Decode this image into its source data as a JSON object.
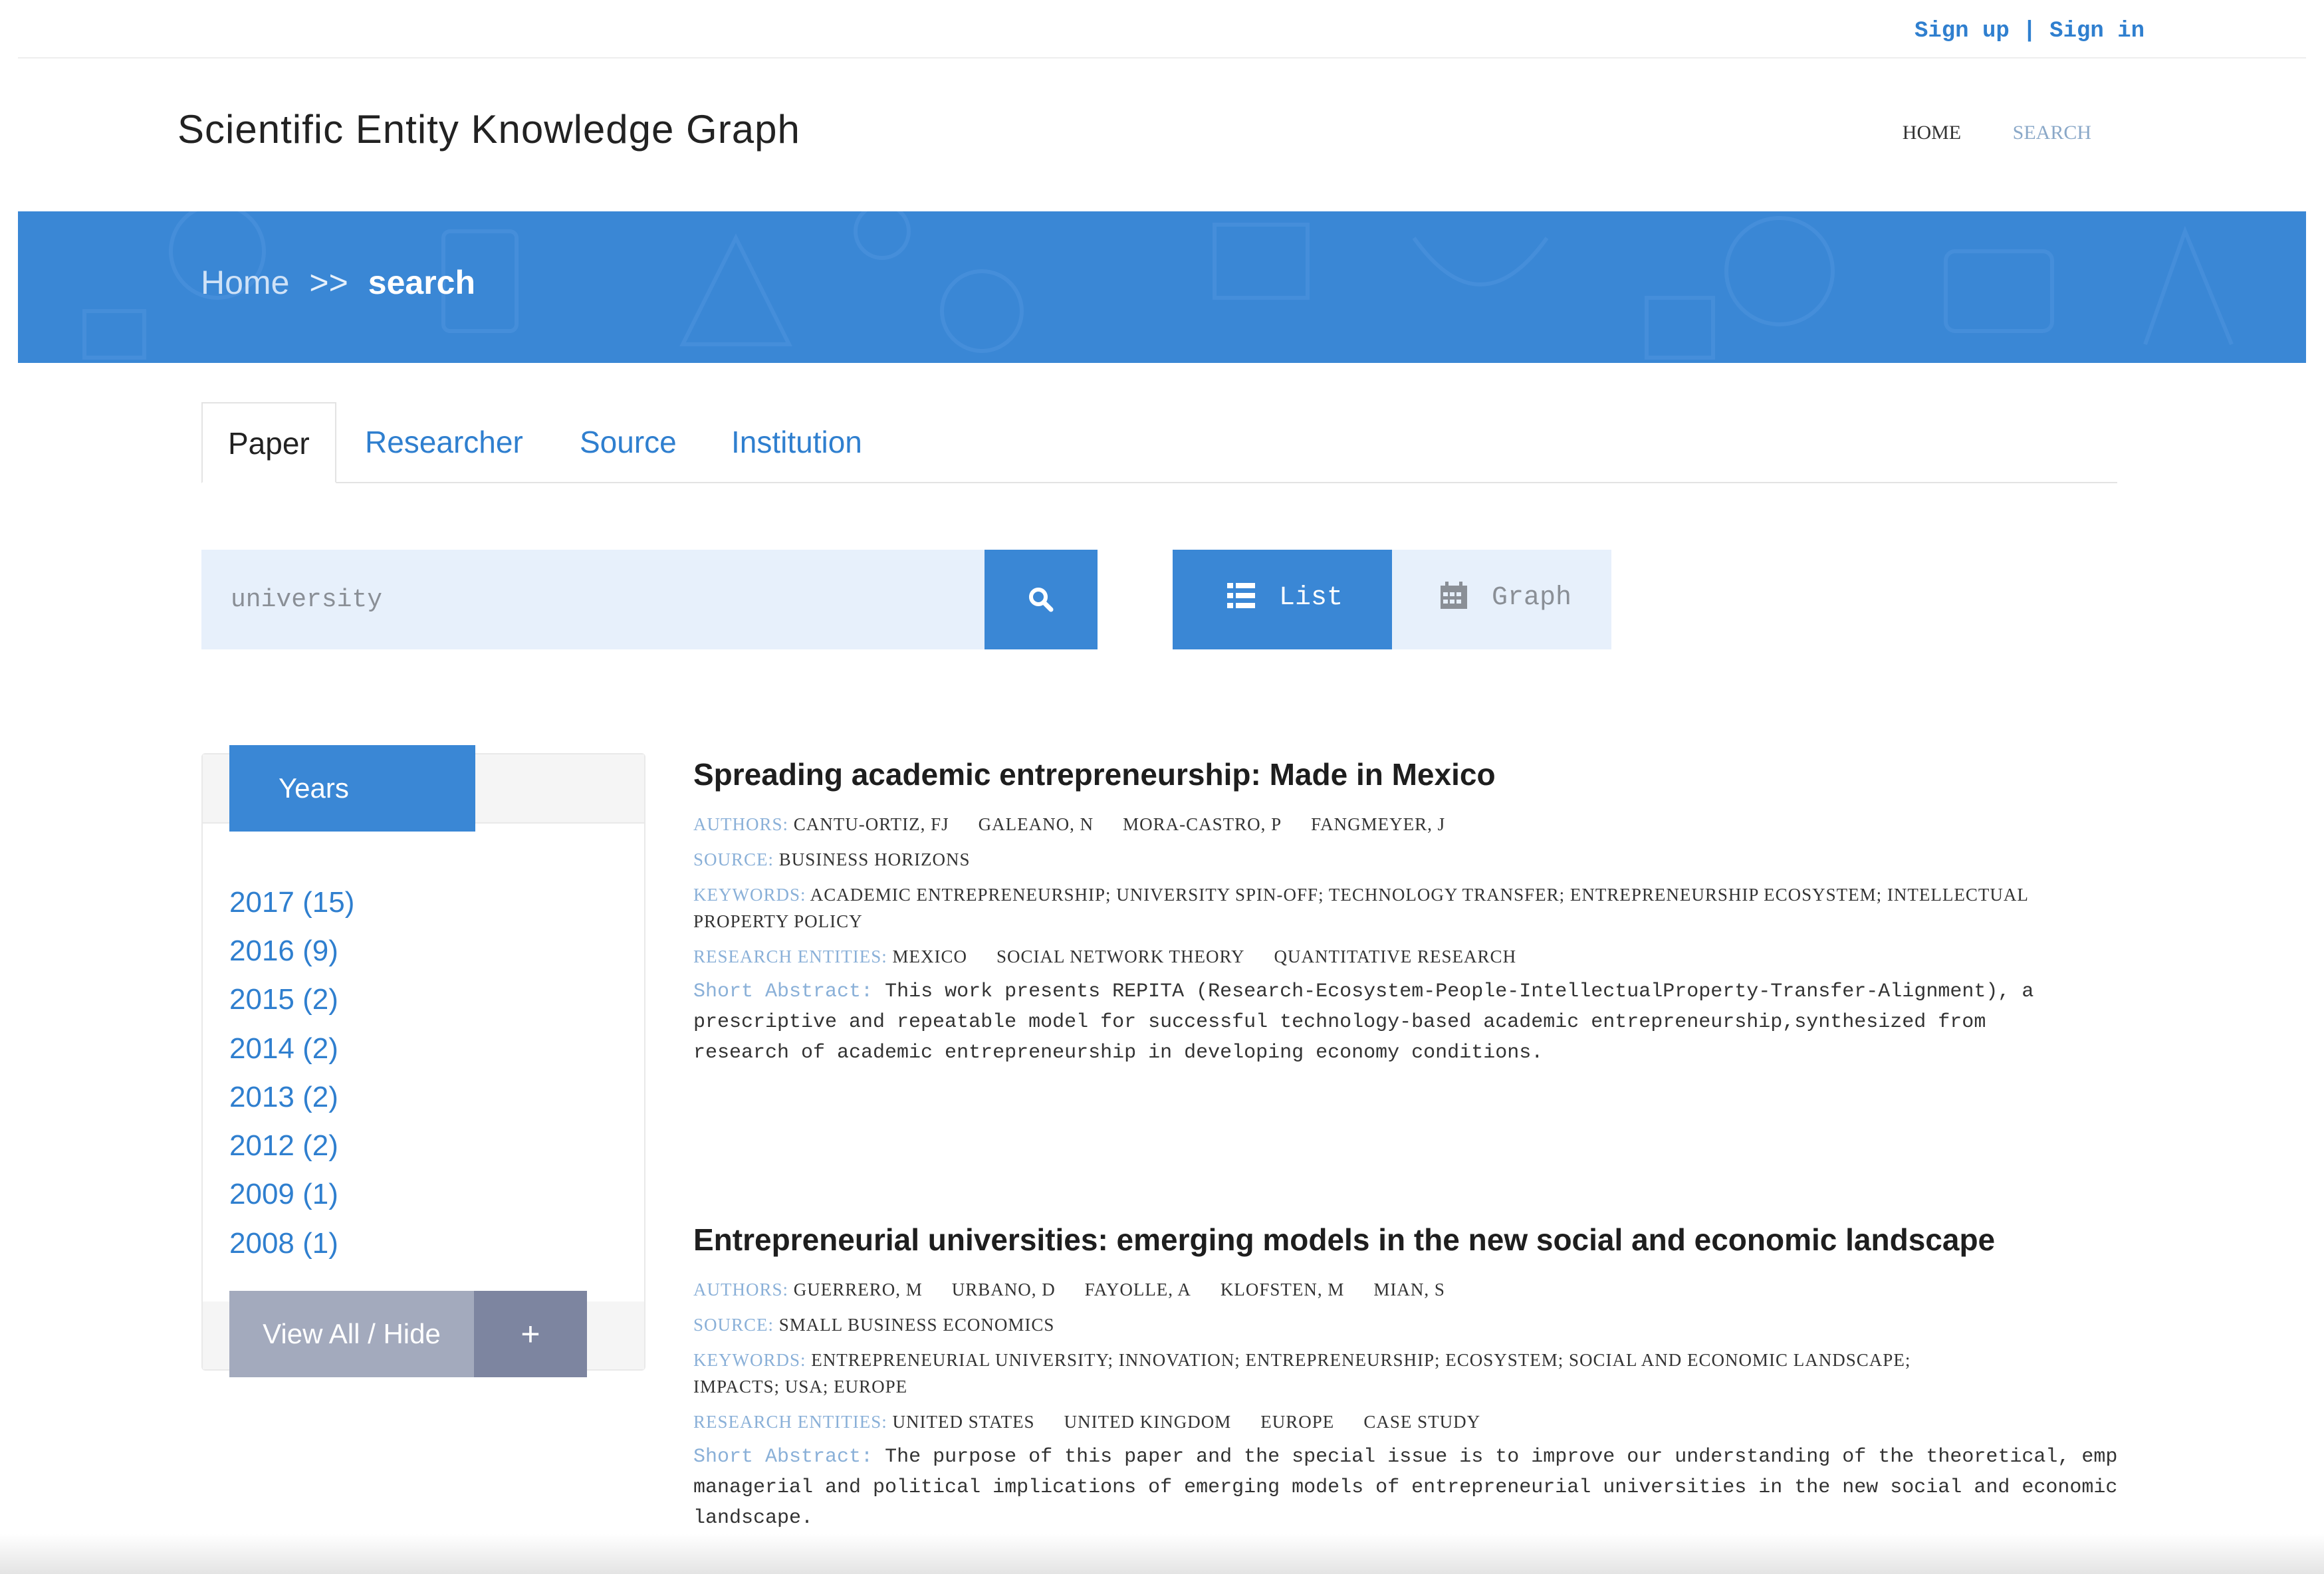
{
  "auth": {
    "signup": "Sign up",
    "separator": "|",
    "signin": "Sign in"
  },
  "site": {
    "title": "Scientific Entity Knowledge Graph"
  },
  "nav": {
    "home": "HOME",
    "search": "SEARCH"
  },
  "breadcrumb": {
    "home": "Home",
    "separator": ">>",
    "current": "search"
  },
  "tabs": [
    "Paper",
    "Researcher",
    "Source",
    "Institution"
  ],
  "search": {
    "value": "university"
  },
  "view": {
    "list": "List",
    "graph": "Graph"
  },
  "filter": {
    "title": "Years",
    "years": [
      "2017 (15)",
      "2016 (9)",
      "2015 (2)",
      "2014 (2)",
      "2013 (2)",
      "2012 (2)",
      "2009 (1)",
      "2008 (1)"
    ],
    "view_all": "View All / Hide",
    "plus": "+"
  },
  "labels": {
    "authors": "AUTHORS:",
    "source": "SOURCE:",
    "keywords": "KEYWORDS:",
    "entities": "RESEARCH ENTITIES:",
    "abstract": "Short Abstract:"
  },
  "results": [
    {
      "title": "Spreading academic entrepreneurship: Made in Mexico",
      "authors": [
        "CANTU-ORTIZ, FJ",
        "GALEANO, N",
        "MORA-CASTRO, P",
        "FANGMEYER, J"
      ],
      "source": "BUSINESS HORIZONS",
      "keywords_line1": "ACADEMIC ENTREPRENEURSHIP; UNIVERSITY SPIN-OFF; TECHNOLOGY TRANSFER; ENTREPRENEURSHIP ECOSYSTEM; INTELLECTUAL",
      "keywords_line2": "PROPERTY POLICY",
      "entities": [
        "MEXICO",
        "SOCIAL NETWORK THEORY",
        "QUANTITATIVE RESEARCH"
      ],
      "abstract_line1": "This work presents REPITA (Research-Ecosystem-People-IntellectualProperty-Transfer-Alignment), a",
      "abstract_line2": "prescriptive and repeatable model for successful technology-based academic entrepreneurship,synthesized from",
      "abstract_line3": "research of academic entrepreneurship in developing economy conditions."
    },
    {
      "title": "Entrepreneurial universities: emerging models in the new social and economic landscape",
      "authors": [
        "GUERRERO, M",
        "URBANO, D",
        "FAYOLLE, A",
        "KLOFSTEN, M",
        "MIAN, S"
      ],
      "source": "SMALL BUSINESS ECONOMICS",
      "keywords_line1": "ENTREPRENEURIAL UNIVERSITY; INNOVATION; ENTREPRENEURSHIP; ECOSYSTEM; SOCIAL AND ECONOMIC LANDSCAPE;",
      "keywords_line2": "IMPACTS; USA; EUROPE",
      "entities": [
        "UNITED STATES",
        "UNITED KINGDOM",
        "EUROPE",
        "CASE STUDY"
      ],
      "abstract_line1": "The purpose of this paper and the special issue is to improve our understanding of the theoretical, emp",
      "abstract_line2": "managerial and political implications of emerging models of entrepreneurial universities in the new social and economic",
      "abstract_line3": "landscape."
    }
  ],
  "icons": {
    "search": "search-icon",
    "list": "list-icon",
    "graph": "calendar-icon"
  },
  "colors": {
    "primary": "#3a87d5",
    "link": "#2f7fcf",
    "label": "#8ab0d8"
  }
}
